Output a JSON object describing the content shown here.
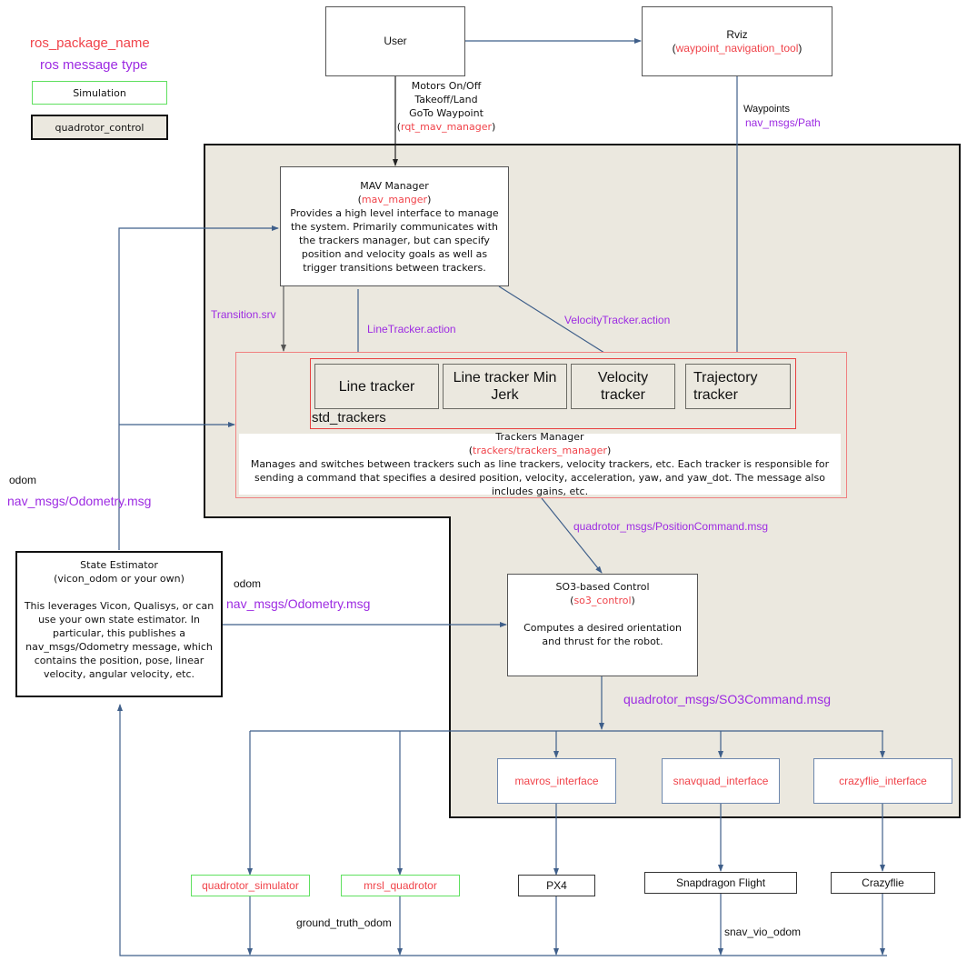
{
  "legend": {
    "package_name": "ros_package_name",
    "message_type": "ros message type",
    "simulation": "Simulation",
    "control_group": "quadrotor_control"
  },
  "nodes": {
    "user": {
      "title": "User"
    },
    "rviz": {
      "title": "Rviz",
      "pkg_open": "(",
      "pkg": "waypoint_navigation_tool",
      "pkg_close": ")"
    },
    "mav_manager": {
      "title": "MAV Manager",
      "pkg_open": "(",
      "pkg": "mav_manger",
      "pkg_close": ")",
      "description": "Provides a high level interface to manage the system. Primarily communicates with the trackers manager, but can specify position and velocity goals as well as trigger transitions between trackers."
    },
    "std_trackers": {
      "label": "std_trackers",
      "trackers": [
        "Line tracker",
        "Line tracker Min Jerk",
        "Velocity tracker",
        "Trajectory tracker"
      ]
    },
    "trackers_manager": {
      "title": "Trackers Manager",
      "pkg_open": "(",
      "pkg": "trackers/trackers_manager",
      "pkg_close": ")",
      "description": "Manages and switches between trackers such as line trackers, velocity trackers, etc. Each tracker is responsible for sending a command that specifies a desired position, velocity, acceleration, yaw, and yaw_dot. The message also includes gains, etc."
    },
    "so3_control": {
      "title": "SO3-based Control",
      "pkg_open": "(",
      "pkg": "so3_control",
      "pkg_close": ")",
      "description": "Computes a desired orientation and thrust for the robot."
    },
    "state_estimator": {
      "title": "State Estimator",
      "subtitle": "(vicon_odom or your own)",
      "description": "This leverages Vicon, Qualisys, or can use your own state estimator. In particular, this publishes a nav_msgs/Odometry message, which contains the position, pose, linear velocity, angular velocity, etc."
    },
    "interfaces": [
      "mavros_interface",
      "snavquad_interface",
      "crazyflie_interface"
    ],
    "hardware": [
      "PX4",
      "Snapdragon Flight",
      "Crazyflie"
    ],
    "simulators": [
      "quadrotor_simulator",
      "mrsl_quadrotor"
    ]
  },
  "edges": {
    "user_cmds": [
      "Motors On/Off",
      "Takeoff/Land",
      "GoTo Waypoint"
    ],
    "user_cmds_pkg_open": "(",
    "user_cmds_pkg": "rqt_mav_manager",
    "user_cmds_pkg_close": ")",
    "waypoints": "Waypoints",
    "waypoints_msg": "nav_msgs/Path",
    "transition": "Transition.srv",
    "line_tracker_action": "LineTracker.action",
    "velocity_tracker_action": "VelocityTracker.action",
    "position_command": "quadrotor_msgs/PositionCommand.msg",
    "so3_command": "quadrotor_msgs/SO3Command.msg",
    "odom_left": "odom",
    "odom_left_msg": "nav_msgs/Odometry.msg",
    "odom_mid": "odom",
    "odom_mid_msg": "nav_msgs/Odometry.msg",
    "ground_truth_odom": "ground_truth_odom",
    "snav_vio_odom": "snav_vio_odom"
  },
  "colors": {
    "package": "#f0434a",
    "message": "#9d2be2",
    "simulation_border": "#5fe05f",
    "control_region": "#ebe8df",
    "wire": "#3f5f8a"
  }
}
